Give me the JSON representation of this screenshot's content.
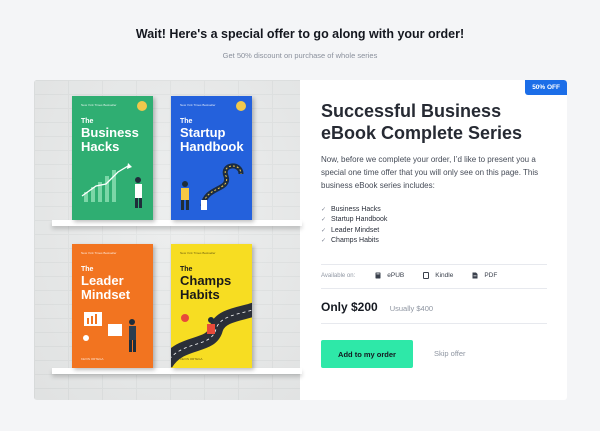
{
  "header": {
    "title": "Wait! Here's a special offer to go along with your order!",
    "subtitle": "Get 50% discount on purchase of whole series"
  },
  "offer": {
    "badge": "50% OFF",
    "title": "Successful Business eBook Complete Series",
    "description": "Now, before we complete your order, I’d like to present you a special one time offer that you will only see on this page. This business eBook series includes:",
    "includes": [
      "Business Hacks",
      "Startup Handbook",
      "Leader Mindset",
      "Champs Habits"
    ],
    "available_label": "Available on:",
    "formats": [
      {
        "label": "ePUB",
        "icon": "book-icon"
      },
      {
        "label": "Kindle",
        "icon": "tablet-icon"
      },
      {
        "label": "PDF",
        "icon": "document-icon"
      }
    ],
    "price": "Only $200",
    "original_price": "Usually $400",
    "cta": "Add to my order",
    "skip": "Skip offer"
  },
  "books": [
    {
      "small": "The",
      "big": "Business Hacks",
      "color": "#2fae72",
      "bestseller": "New York Times Bestseller",
      "author": "KEVIN ORTEGA"
    },
    {
      "small": "The",
      "big": "Startup Handbook",
      "color": "#2461dc",
      "bestseller": "New York Times Bestseller",
      "author": "KEVIN ORTEGA"
    },
    {
      "small": "The",
      "big": "Leader Mindset",
      "color": "#f27420",
      "bestseller": "New York Times Bestseller",
      "author": "KEVIN ORTEGA"
    },
    {
      "small": "The",
      "big": "Champs Habits",
      "color": "#f7dd22",
      "bestseller": "New York Times Bestseller",
      "author": "KEVIN ORTEGA"
    }
  ],
  "colors": {
    "accent": "#2ee8a8",
    "badge": "#1c6ee8"
  }
}
